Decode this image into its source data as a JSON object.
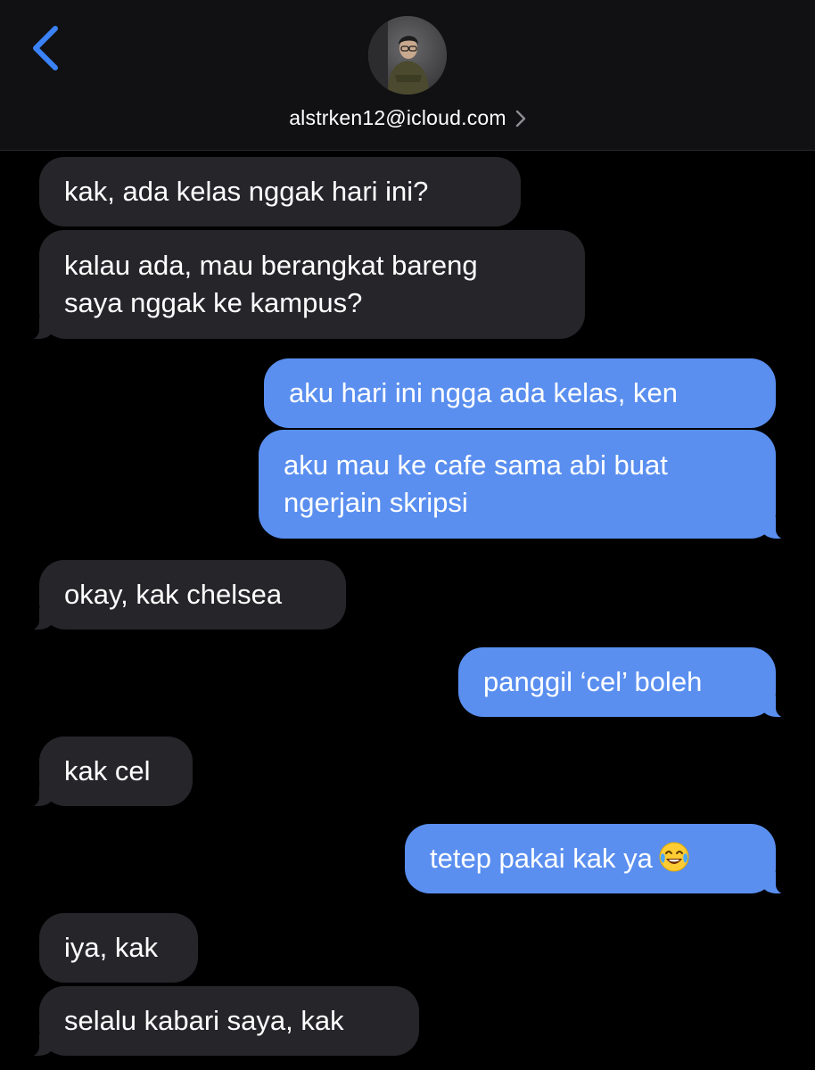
{
  "header": {
    "contact_name": "alstrken12@icloud.com",
    "back_icon": "chevron-left-icon",
    "disclosure_icon": "chevron-right-icon",
    "accent_color": "#3b82f6"
  },
  "messages": [
    {
      "direction": "received",
      "lines": [
        "kak, ada kelas nggak hari ini?"
      ]
    },
    {
      "direction": "received",
      "lines": [
        "kalau ada, mau berangkat bareng",
        "saya nggak ke kampus?"
      ]
    },
    {
      "direction": "sent",
      "lines": [
        "aku hari ini ngga ada kelas, ken"
      ]
    },
    {
      "direction": "sent",
      "lines": [
        "aku mau ke cafe sama abi buat",
        "ngerjain skripsi"
      ]
    },
    {
      "direction": "received",
      "lines": [
        "okay, kak chelsea"
      ]
    },
    {
      "direction": "sent",
      "lines": [
        "panggil ‘cel’ boleh"
      ]
    },
    {
      "direction": "received",
      "lines": [
        "kak cel"
      ]
    },
    {
      "direction": "sent",
      "lines": [
        "tetep pakai kak ya"
      ],
      "emoji": "face-with-tears-of-joy-icon"
    },
    {
      "direction": "received",
      "lines": [
        "iya, kak"
      ]
    },
    {
      "direction": "received",
      "lines": [
        "selalu kabari saya, kak"
      ]
    }
  ],
  "colors": {
    "sent_bubble": "#5a8ff0",
    "received_bubble": "#26252a",
    "background": "#000000",
    "header_background": "#111113"
  }
}
